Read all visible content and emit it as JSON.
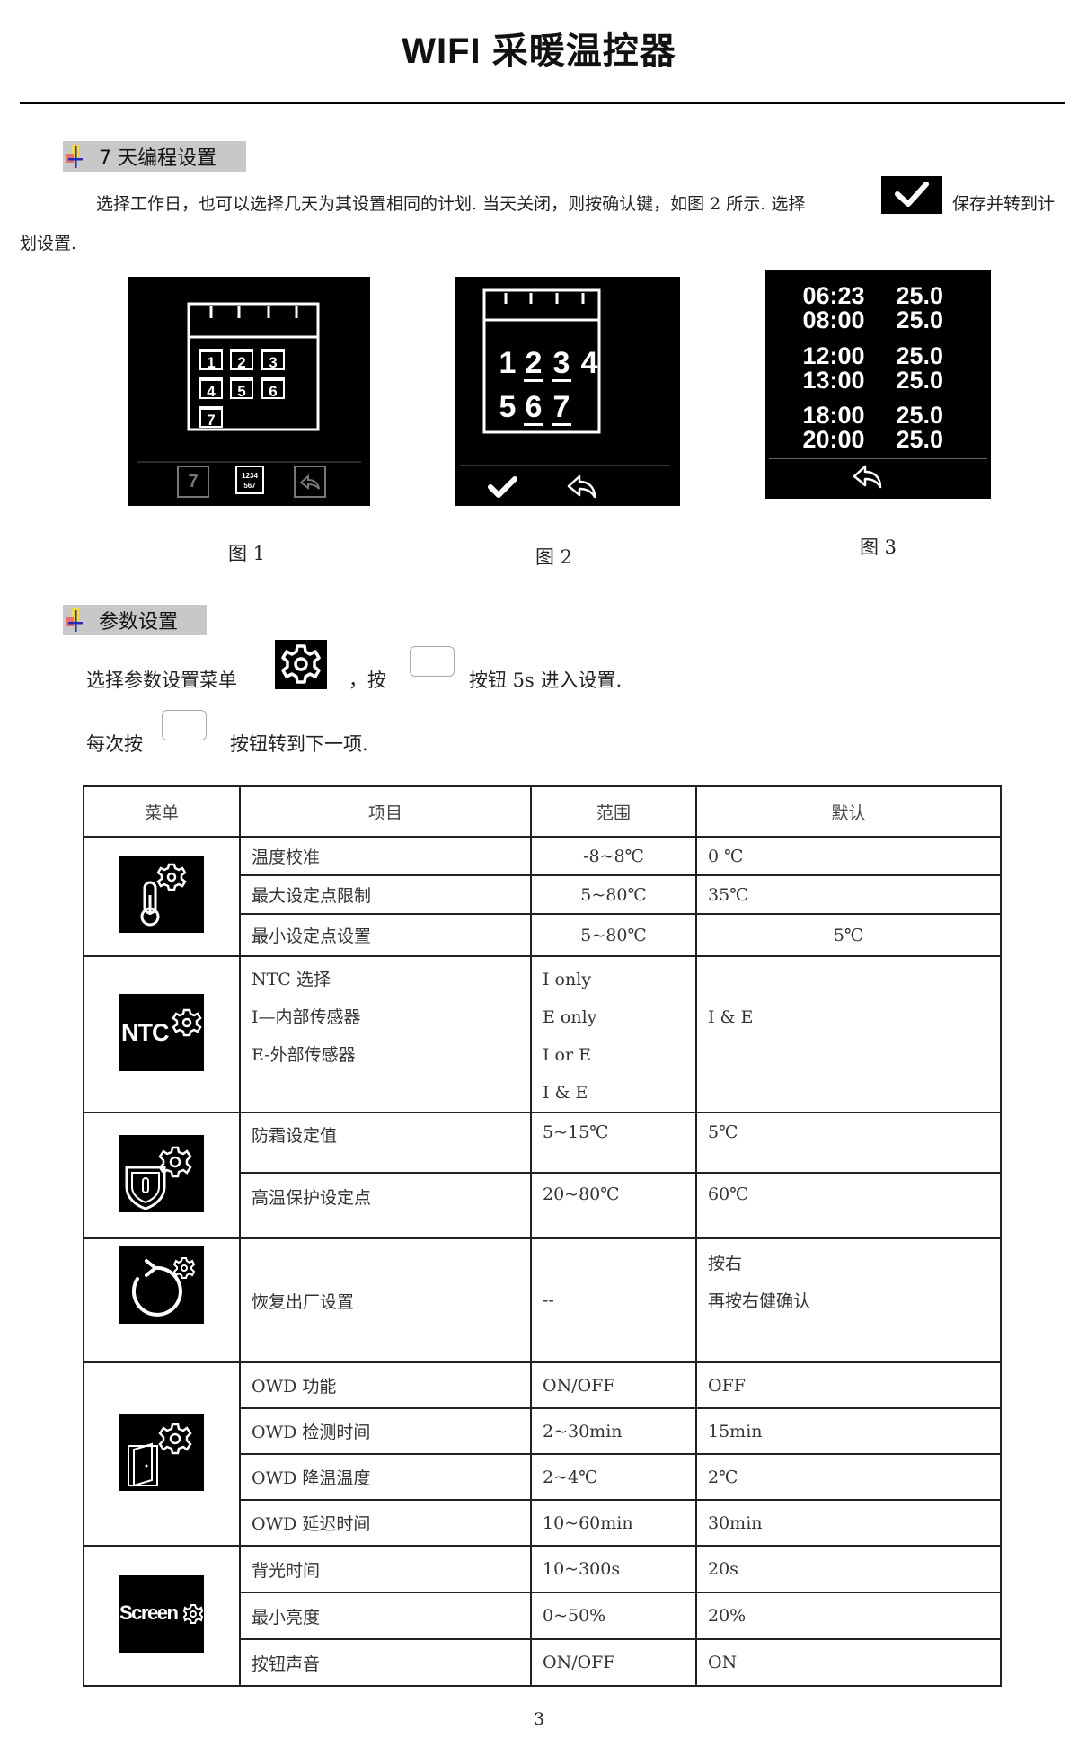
{
  "document": {
    "title": "WIFI  采暖温控器",
    "page_number": "3"
  },
  "section1": {
    "heading": "7 天编程设置",
    "paragraph_part1": "选择工作日，也可以选择几天为其设置相同的计划. 当天关闭，则按确认键，如图 2 所示. 选择",
    "paragraph_part2": "保存并转到计",
    "paragraph_part3": "划设置.",
    "figures": [
      {
        "caption": "图 1",
        "day_tiles": [
          "1",
          "2",
          "3",
          "4",
          "5",
          "6",
          "7"
        ],
        "bottom_icons": [
          "single-day-7-icon",
          "week-1234567-icon",
          "back-icon"
        ],
        "mini_week_line1": "1234",
        "mini_week_line2": "567",
        "single_day_label": "7"
      },
      {
        "caption": "图 2",
        "days_row1": [
          "1",
          "2",
          "3",
          "4"
        ],
        "days_row2": [
          "5",
          "6",
          "7"
        ],
        "selected_days": [
          "2",
          "3",
          "6",
          "7"
        ],
        "bottom_icons": [
          "check-icon",
          "back-icon"
        ]
      },
      {
        "caption": "图 3",
        "schedule": [
          {
            "time": "06:23",
            "temp": "25.0"
          },
          {
            "time": "08:00",
            "temp": "25.0"
          },
          {
            "time": "12:00",
            "temp": "25.0"
          },
          {
            "time": "13:00",
            "temp": "25.0"
          },
          {
            "time": "18:00",
            "temp": "25.0"
          },
          {
            "time": "20:00",
            "temp": "25.0"
          }
        ],
        "bottom_icons": [
          "back-icon"
        ]
      }
    ]
  },
  "section2": {
    "heading": "参数设置",
    "line1_part1": "选择参数设置菜单",
    "line1_part2": "，按",
    "line1_part3": "按钮 5s  进入设置.",
    "line2_part1": "每次按",
    "line2_part2": "按钮转到下一项."
  },
  "table": {
    "headers": [
      "菜单",
      "项目",
      "范围",
      "默认"
    ],
    "groups": [
      {
        "icon": "thermometer-gear-icon",
        "rows": [
          {
            "item": "温度校准",
            "range": "-8~8℃",
            "default": "0 ℃"
          },
          {
            "item": "最大设定点限制",
            "range": "5~80℃",
            "default": "35℃"
          },
          {
            "item": "最小设定点设置",
            "range": "5~80℃",
            "default": "5℃"
          }
        ]
      },
      {
        "icon": "ntc-gear-icon",
        "icon_text": "NTC",
        "items": [
          "NTC  选择",
          "I—内部传感器",
          "E-外部传感器"
        ],
        "ranges": [
          "I only",
          "E only",
          "I or E",
          "I & E"
        ],
        "default": "I & E"
      },
      {
        "icon": "shield-thermometer-gear-icon",
        "rows": [
          {
            "item": "防霜设定值",
            "range": "5~15℃",
            "default": "5℃"
          },
          {
            "item": "高温保护设定点",
            "range": "20~80℃",
            "default": "60℃"
          }
        ]
      },
      {
        "icon": "reset-gear-icon",
        "rows": [
          {
            "item": "恢复出厂设置",
            "range": "--",
            "default_lines": [
              "按右",
              "再按右健确认"
            ]
          }
        ]
      },
      {
        "icon": "door-gear-icon",
        "rows": [
          {
            "item": "OWD  功能",
            "range": "ON/OFF",
            "default": "OFF"
          },
          {
            "item": "OWD  检测时间",
            "range": "2~30min",
            "default": "15min"
          },
          {
            "item": "OWD  降温温度",
            "range": "2~4℃",
            "default": "2℃"
          },
          {
            "item": "OWD  延迟时间",
            "range": "10~60min",
            "default": "30min"
          }
        ]
      },
      {
        "icon": "screen-gear-icon",
        "icon_text": "Screen",
        "rows": [
          {
            "item": "背光时间",
            "range": "10~300s",
            "default": "20s"
          },
          {
            "item": "最小亮度",
            "range": "0~50%",
            "default": "20%"
          },
          {
            "item": "按钮声音",
            "range": "ON/OFF",
            "default": "ON"
          }
        ]
      }
    ]
  }
}
